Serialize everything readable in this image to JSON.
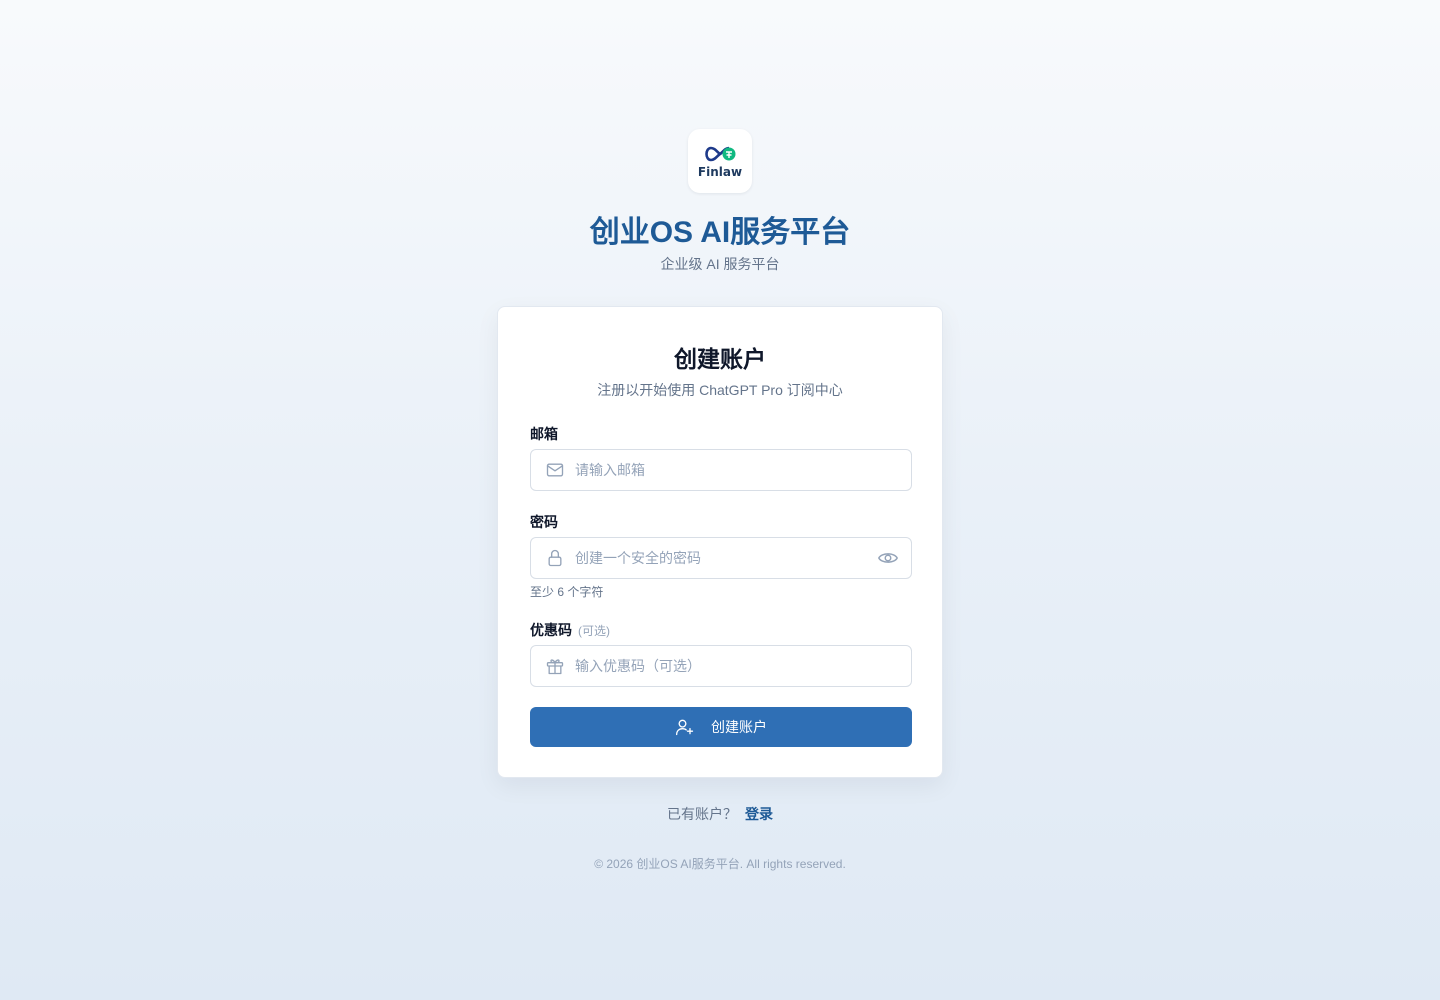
{
  "brand": {
    "logo_text": "Finlaw",
    "title": "创业OS AI服务平台",
    "subtitle": "企业级 AI 服务平台",
    "colors": {
      "primary": "#1e5a96",
      "button": "#2f6fb5",
      "logo_green": "#10b981"
    }
  },
  "card": {
    "title": "创建账户",
    "subtitle": "注册以开始使用 ChatGPT Pro 订阅中心"
  },
  "form": {
    "email": {
      "label": "邮箱",
      "placeholder": "请输入邮箱",
      "value": "",
      "icon": "mail-icon"
    },
    "password": {
      "label": "密码",
      "placeholder": "创建一个安全的密码",
      "value": "",
      "hint": "至少 6 个字符",
      "icon": "lock-icon",
      "toggle_icon": "eye-icon"
    },
    "coupon": {
      "label": "优惠码",
      "optional_tag": "(可选)",
      "placeholder": "输入优惠码（可选）",
      "value": "",
      "icon": "gift-icon"
    },
    "submit_label": "创建账户",
    "submit_icon": "user-plus-icon"
  },
  "signin": {
    "prompt": "已有账户？",
    "link_label": "登录"
  },
  "footer": {
    "copyright": "© 2026 创业OS AI服务平台. All rights reserved."
  }
}
